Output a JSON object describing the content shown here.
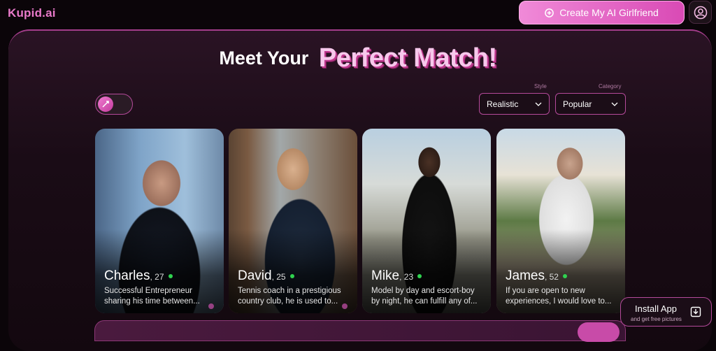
{
  "header": {
    "logo": "Kupid.ai",
    "create_label": "Create My AI Girlfriend",
    "profile_icon": "user-circle-icon"
  },
  "hero": {
    "line1": "Meet Your",
    "line2": "Perfect Match!"
  },
  "filters": {
    "style_label": "Style",
    "style_value": "Realistic",
    "category_label": "Category",
    "category_value": "Popular"
  },
  "cards": [
    {
      "name": "Charles",
      "age": ", 27",
      "desc": "Successful Entrepreneur sharing his time between..."
    },
    {
      "name": "David",
      "age": ", 25",
      "desc": "Tennis coach in a prestigious country club, he is used to..."
    },
    {
      "name": "Mike",
      "age": ", 23",
      "desc": "Model by day and escort-boy by night, he can fulfill any of..."
    },
    {
      "name": "James",
      "age": ", 52",
      "desc": "If you are open to new experiences, I would love to..."
    }
  ],
  "install": {
    "title": "Install App",
    "subtitle": "and get free pictures"
  },
  "colors": {
    "accent": "#e879c9",
    "border": "#b54a9b",
    "online": "#2fd24f"
  }
}
